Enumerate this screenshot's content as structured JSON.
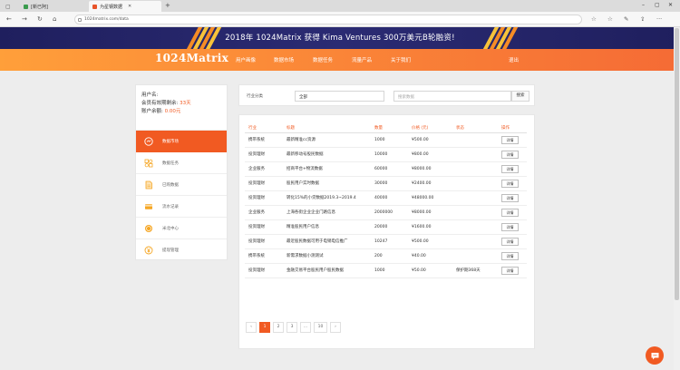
{
  "browser": {
    "tabs": [
      {
        "label": "[新已阿]",
        "color": "#3a9b4d"
      },
      {
        "label": "为星钢数据",
        "color": "#e8542a"
      }
    ],
    "url": "1024matrix.com/data"
  },
  "banner": {
    "text": "2018年 1024Matrix 获得 Kima Ventures 300万美元B轮融资!"
  },
  "site": {
    "logo": "1024Matrix",
    "nav": [
      "用户画像",
      "数据市场",
      "数据任务",
      "流量产品",
      "关于我们"
    ],
    "logout": "退出"
  },
  "user": {
    "name_label": "用户名:",
    "days_label": "会员有效期剩余: ",
    "days_value": "33天",
    "balance_label": "账户余额: ",
    "balance_value": "0.00元"
  },
  "menu": [
    {
      "label": "数据市场",
      "icon": "market-icon",
      "active": true
    },
    {
      "label": "数据任务",
      "icon": "puzzle-icon",
      "active": false
    },
    {
      "label": "已购数据",
      "icon": "document-icon",
      "active": false
    },
    {
      "label": "流水记录",
      "icon": "card-icon",
      "active": false
    },
    {
      "label": "米北中心",
      "icon": "coin-icon",
      "active": false
    },
    {
      "label": "提现管理",
      "icon": "yen-icon",
      "active": false
    }
  ],
  "filter": {
    "label": "行业分类",
    "selected": "全部",
    "search_placeholder": "搜索数据",
    "search_button": "搜索"
  },
  "table": {
    "headers": [
      "行业",
      "标题",
      "数量",
      "价格 (元)",
      "状态",
      "操作"
    ],
    "rows": [
      [
        "携带系统",
        "最新精准cc资源",
        "1000",
        "¥500.00",
        "",
        "详情"
      ],
      [
        "投资理财",
        "最新移动号股民数据",
        "10000",
        "¥800.00",
        "",
        "详情"
      ],
      [
        "企业服务",
        "招商平台+物流数据",
        "60000",
        "¥8000.00",
        "",
        "详情"
      ],
      [
        "投资理财",
        "股民用户实时数据",
        "30000",
        "¥2400.00",
        "",
        "详情"
      ],
      [
        "投资理财",
        "转化15%的小贷数据2019.3~2019.4",
        "40000",
        "¥48000.00",
        "",
        "详情"
      ],
      [
        "企业服务",
        "上海各街企业企业门路信息",
        "2000000",
        "¥8000.00",
        "",
        "详情"
      ],
      [
        "投资理财",
        "精准股民用户信息",
        "20000",
        "¥1600.00",
        "",
        "详情"
      ],
      [
        "投资理财",
        "最近股民数据可用于电销电信推广",
        "10247",
        "¥500.00",
        "",
        "详情"
      ],
      [
        "携带系统",
        "新需求数据小测测试",
        "200",
        "¥40.00",
        "",
        "详情"
      ],
      [
        "投资理财",
        "金融交易平台股民用户股民数据",
        "1000",
        "¥50.00",
        "保护期368天",
        "详情"
      ]
    ]
  },
  "pagination": [
    "‹",
    "1",
    "2",
    "3",
    "...",
    "10",
    "›"
  ],
  "colors": {
    "accent": "#f15a22",
    "banner": "#25256a"
  }
}
